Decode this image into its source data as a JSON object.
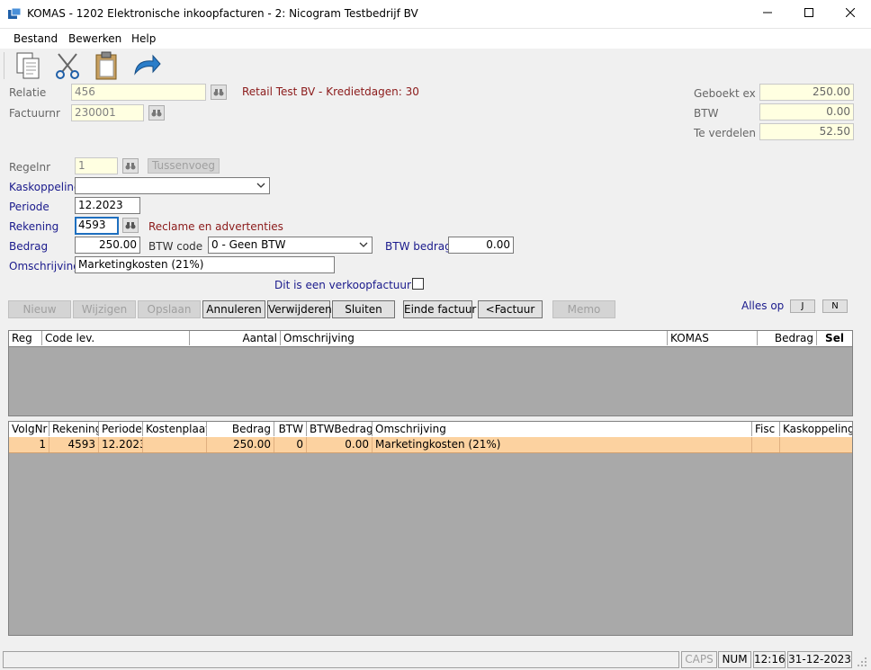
{
  "window": {
    "title": "KOMAS - 1202 Elektronische inkoopfacturen - 2: Nicogram Testbedrijf BV",
    "minimize": "—",
    "maximize": "☐",
    "close": "✕"
  },
  "menu": {
    "bestand": "Bestand",
    "bewerken": "Bewerken",
    "help": "Help"
  },
  "header": {
    "relatie_label": "Relatie",
    "relatie_value": "456",
    "factuurnr_label": "Factuurnr",
    "factuurnr_value": "230001",
    "relatie_info": "Retail Test BV - Kredietdagen: 30",
    "geboekt_ex_label": "Geboekt ex",
    "geboekt_ex_value": "250.00",
    "btw_label": "BTW",
    "btw_value": "0.00",
    "te_verdelen_label": "Te verdelen",
    "te_verdelen_value": "52.50"
  },
  "line": {
    "regelnr_label": "Regelnr",
    "regelnr_value": "1",
    "tussenvoegen_label": "Tussenvoeg",
    "kaskoppeling_label": "Kaskoppeling",
    "kaskoppeling_value": "",
    "periode_label": "Periode",
    "periode_value": "12.2023",
    "rekening_label": "Rekening",
    "rekening_value": "4593",
    "rekening_info": "Reclame en advertenties",
    "bedrag_label": "Bedrag",
    "bedrag_value": "250.00",
    "btw_code_label": "BTW code",
    "btw_code_value": "0 - Geen BTW",
    "btw_bedrag_label": "BTW bedrag",
    "btw_bedrag_value": "0.00",
    "omschrijving_label": "Omschrijving",
    "omschrijving_value": "Marketingkosten (21%)",
    "verkoopfactuur_label": "Dit is een verkoopfactuur"
  },
  "buttons": {
    "nieuw": "Nieuw",
    "wijzigen": "Wijzigen",
    "opslaan": "Opslaan",
    "annuleren": "Annuleren",
    "verwijderen": "Verwijderen",
    "sluiten": "Sluiten",
    "einde_factuur": "Einde factuur",
    "factuur": "<Factuur",
    "memo": "Memo",
    "alles_op": "Alles op",
    "j": "J",
    "n": "N"
  },
  "grid1": {
    "headers": [
      "Reg",
      "Code lev.",
      "Aantal",
      "Omschrijving",
      "KOMAS",
      "Bedrag",
      "Sel"
    ]
  },
  "grid2": {
    "headers": [
      "VolgNr",
      "Rekening",
      "Periode",
      "Kostenplaats",
      "Bedrag",
      "BTW",
      "BTWBedrag",
      "Omschrijving",
      "Fisc",
      "Kaskoppeling"
    ],
    "rows": [
      [
        "1",
        "4593",
        "12.2023",
        "",
        "250.00",
        "0",
        "0.00",
        "Marketingkosten (21%)",
        "",
        ""
      ]
    ]
  },
  "status": {
    "caps": "CAPS",
    "num": "NUM",
    "time": "12:16",
    "date": "31-12-2023"
  },
  "colors": {
    "row_highlight": "#fcd2a0",
    "grid_bg": "#a9a9a9",
    "label_blue": "#1a1a8c",
    "info_red": "#8b1a1a",
    "readonly_bg": "#ffffe1"
  }
}
